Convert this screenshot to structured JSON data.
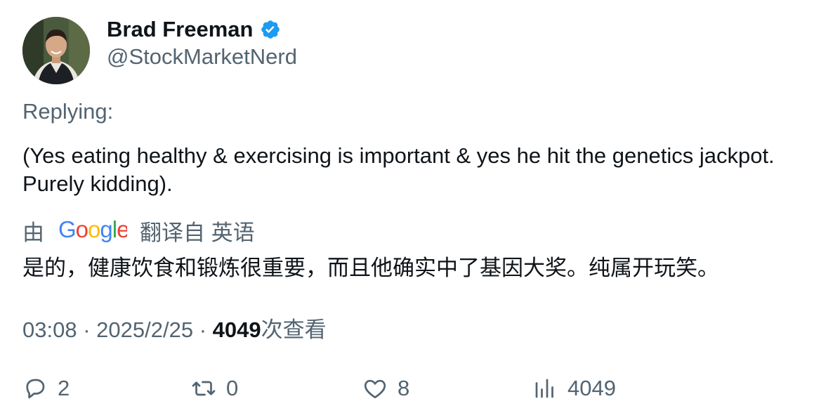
{
  "user": {
    "name": "Brad Freeman",
    "handle": "@StockMarketNerd"
  },
  "replying_label": "Replying:",
  "tweet": {
    "text_line1": "(Yes eating healthy & exercising is important & yes he hit the genetics jackpot.",
    "text_line2": "Purely kidding)."
  },
  "translation": {
    "prefix": "由",
    "provider": "Google",
    "suffix": "翻译自 英语",
    "text": "是的，健康饮食和锻炼很重要，而且他确实中了基因大奖。纯属开玩笑。"
  },
  "meta": {
    "time": "03:08",
    "sep1": "·",
    "date": "2025/2/25",
    "sep2": "·",
    "views_count": "4049",
    "views_label": "次查看"
  },
  "actions": {
    "replies": "2",
    "retweets": "0",
    "likes": "8",
    "views": "4049"
  },
  "colors": {
    "verified_blue": "#1d9bf0",
    "secondary_text": "#536471",
    "primary_text": "#0f1419"
  }
}
